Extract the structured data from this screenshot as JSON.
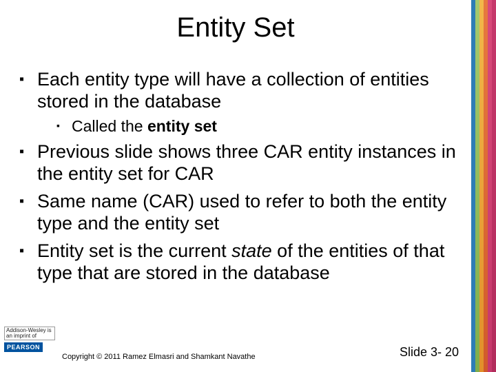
{
  "title": "Entity Set",
  "bullets": [
    {
      "text": "Each entity type will have a collection of entities stored in the database",
      "sub": [
        {
          "pre": "Called the ",
          "bold": "entity set"
        }
      ]
    },
    {
      "text": "Previous slide shows three CAR entity instances in the entity set for CAR"
    },
    {
      "text": "Same name (CAR) used to refer to both the entity type and the entity set"
    },
    {
      "pre": "Entity set is the current ",
      "ital": "state",
      "post": " of the entities of that type that are stored in the database"
    }
  ],
  "logo": {
    "aw": "Addison-Wesley is an imprint of",
    "pearson": "PEARSON"
  },
  "copyright": "Copyright © 2011 Ramez Elmasri and Shamkant Navathe",
  "slidenum": "Slide 3- 20"
}
